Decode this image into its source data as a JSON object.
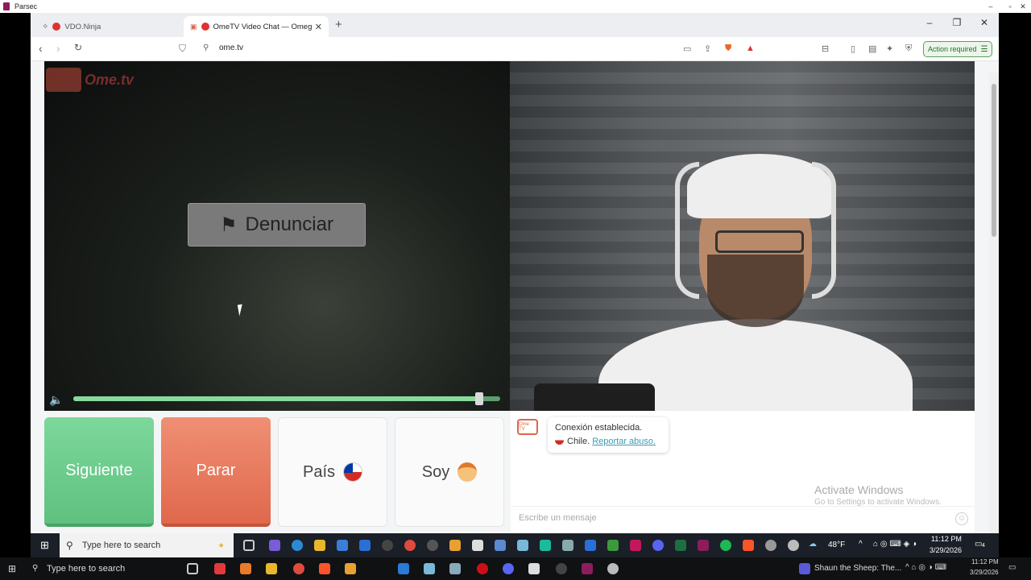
{
  "parsec": {
    "title": "Parsec"
  },
  "browser": {
    "tabs": [
      {
        "label": "VDO.Ninja",
        "active": false
      },
      {
        "label": "OmeTV Video Chat — Omeg",
        "active": true
      }
    ],
    "url": "ome.tv",
    "action_required": "Action required"
  },
  "ometv": {
    "logo": "Ome.tv",
    "report_button": "Denunciar",
    "volume_level": 0.95,
    "buttons": {
      "next": "Siguiente",
      "stop": "Parar",
      "country": "País",
      "gender": "Soy"
    },
    "chat": {
      "logo_text": "Ome TV",
      "connection": "Conexión establecida.",
      "country": "Chile.",
      "report_link": "Reportar abuso.",
      "placeholder": "Escribe un mensaje"
    },
    "watermark": {
      "line1": "Activate Windows",
      "line2": "Go to Settings to activate Windows."
    }
  },
  "remote_taskbar": {
    "search": "Type here to search",
    "weather": "48°F",
    "time": "11:12 PM",
    "date": "3/29/2026",
    "notifications": "4"
  },
  "host_taskbar": {
    "search": "Type here to search",
    "media": "Shaun the Sheep: The...",
    "time": "11:12 PM",
    "date": "3/29/2026"
  },
  "colors": {
    "green": "#5fc17f",
    "red": "#e0684c",
    "link": "#3a9bb4"
  }
}
